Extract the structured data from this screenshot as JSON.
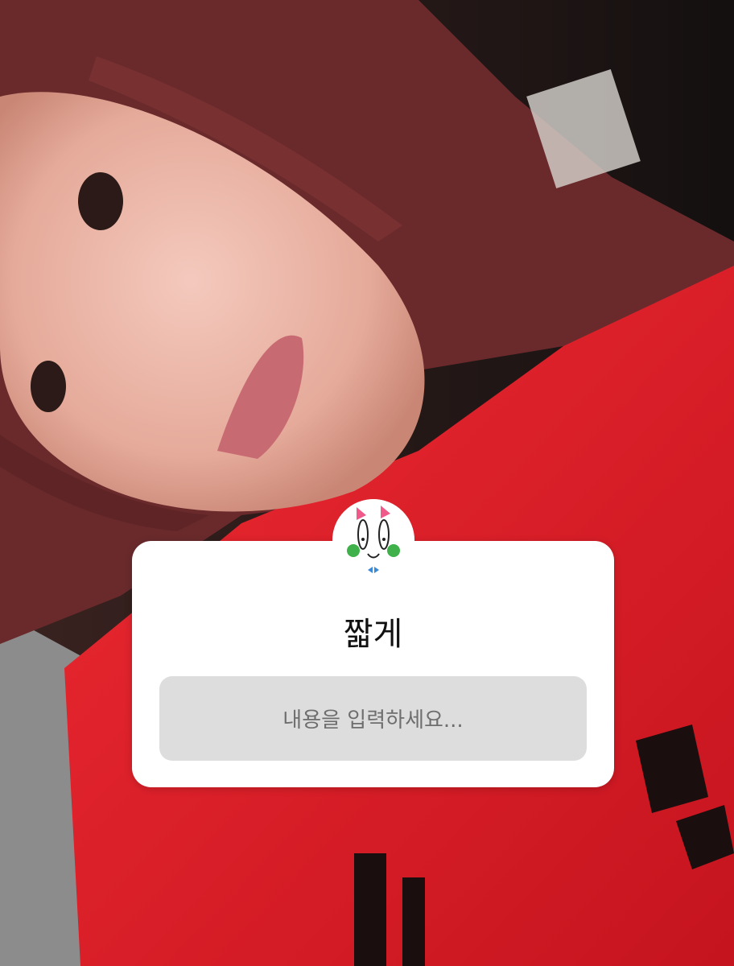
{
  "question_sticker": {
    "title": "짧게",
    "answer_placeholder": "내용을 입력하세요..."
  },
  "background": {
    "shirt_color": "#e8242c",
    "hair_color": "#6a2a2c"
  }
}
